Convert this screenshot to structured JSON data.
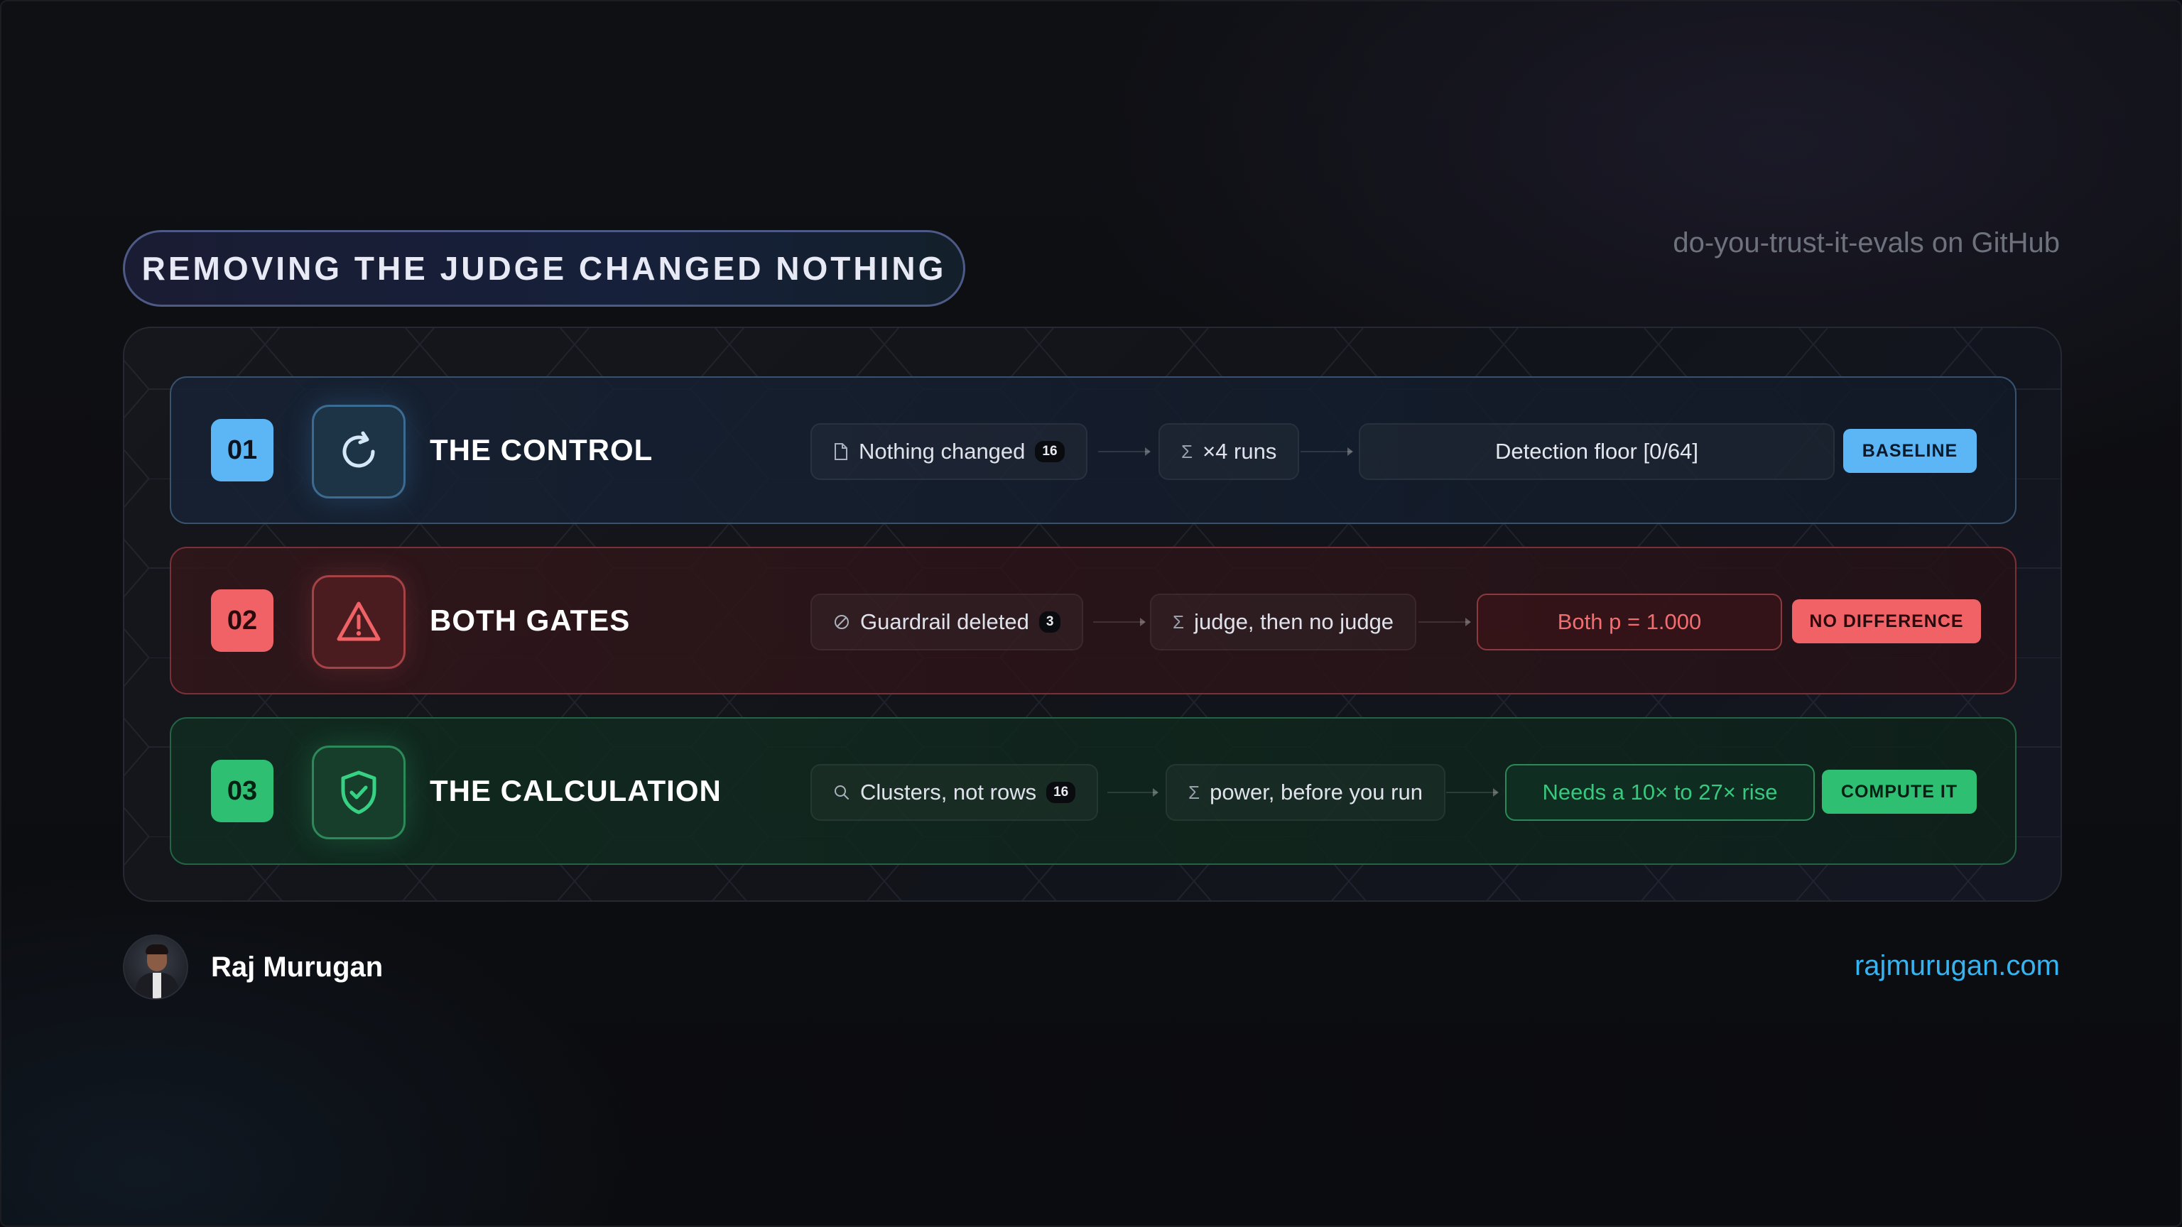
{
  "title": "REMOVING THE JUDGE CHANGED NOTHING",
  "source": "do-you-trust-it-evals on GitHub",
  "rows": [
    {
      "number": "01",
      "icon": "refresh-icon",
      "title": "THE CONTROL",
      "input_label": "Nothing changed",
      "input_icon": "document-icon",
      "input_count": "16",
      "step_symbol": "Σ",
      "step_label": "×4 runs",
      "result": "Detection floor [0/64]",
      "badge": "BASELINE",
      "accent": "#5cb6f5"
    },
    {
      "number": "02",
      "icon": "warning-icon",
      "title": "BOTH GATES",
      "input_label": "Guardrail deleted",
      "input_icon": "prohibited-icon",
      "input_count": "3",
      "step_symbol": "Σ",
      "step_label": "judge, then no judge",
      "result": "Both p = 1.000",
      "badge": "NO DIFFERENCE",
      "accent": "#f06265"
    },
    {
      "number": "03",
      "icon": "shield-check-icon",
      "title": "THE CALCULATION",
      "input_label": "Clusters, not rows",
      "input_icon": "search-icon",
      "input_count": "16",
      "step_symbol": "Σ",
      "step_label": "power, before you run",
      "result": "Needs a 10× to 27× rise",
      "badge": "COMPUTE IT",
      "accent": "#2fbf72"
    }
  ],
  "author": {
    "name": "Raj Murugan",
    "site": "rajmurugan.com"
  }
}
